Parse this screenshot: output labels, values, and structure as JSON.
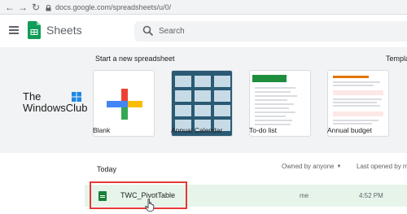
{
  "browser": {
    "url": "docs.google.com/spreadsheets/u/0/"
  },
  "app": {
    "name": "Sheets",
    "search_placeholder": "Search"
  },
  "templates": {
    "heading": "Start a new spreadsheet",
    "gallery_label": "Templat",
    "items": [
      {
        "label": "Blank"
      },
      {
        "label": "Annual Calendar"
      },
      {
        "label": "To-do list"
      },
      {
        "label": "Annual budget"
      }
    ]
  },
  "watermark": {
    "line1": "The",
    "line2": "WindowsClub"
  },
  "files": {
    "section": "Today",
    "owner_filter": "Owned by anyone",
    "sort_label": "Last opened by m",
    "rows": [
      {
        "name": "TWC_PivotTable",
        "owner": "me",
        "time": "4:52 PM"
      }
    ]
  },
  "colors": {
    "accent": "#188038",
    "highlight": "#e53935",
    "row_bg": "#e6f4ea"
  }
}
